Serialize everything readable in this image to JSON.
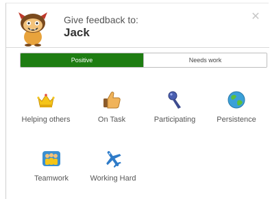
{
  "header": {
    "prefix": "Give feedback to:",
    "student_name": "Jack",
    "avatar_icon": "monster-avatar-icon",
    "close_icon": "close-icon"
  },
  "tabs": [
    {
      "label": "Positive",
      "active": true
    },
    {
      "label": "Needs work",
      "active": false
    }
  ],
  "skills": [
    {
      "label": "Helping others",
      "icon": "crown-icon"
    },
    {
      "label": "On Task",
      "icon": "thumbs-up-icon"
    },
    {
      "label": "Participating",
      "icon": "microphone-icon"
    },
    {
      "label": "Persistence",
      "icon": "globe-icon"
    },
    {
      "label": "Teamwork",
      "icon": "team-icon"
    },
    {
      "label": "Working Hard",
      "icon": "airplane-icon"
    }
  ],
  "colors": {
    "positive_tab": "#1e7d12",
    "border": "#bdbdbd"
  }
}
